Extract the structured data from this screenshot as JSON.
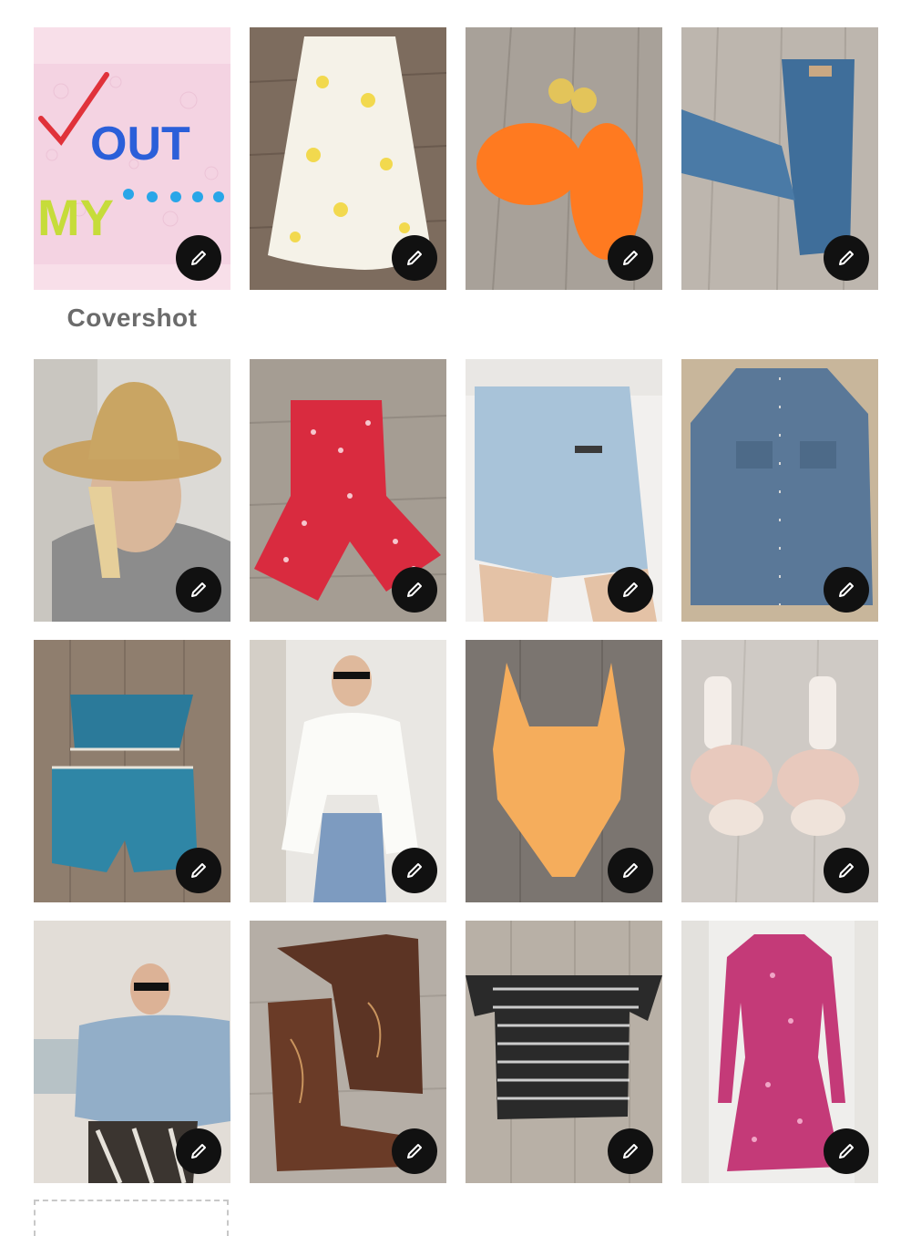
{
  "cover": {
    "label": "Covershot"
  },
  "edit_icon": "pencil-icon",
  "colors": {
    "edit_button": "#111111",
    "cover_label": "#6b6b6b",
    "wood_floor": "#8a7a6a"
  },
  "photos": [
    {
      "subject": "cover graphic",
      "caption_text": "✓OUT MY...."
    },
    {
      "subject": "white floral skirt"
    },
    {
      "subject": "orange jelly sandals"
    },
    {
      "subject": "blue jeans"
    },
    {
      "subject": "woman in straw hat"
    },
    {
      "subject": "red floral romper"
    },
    {
      "subject": "denim shorts"
    },
    {
      "subject": "denim western shirt"
    },
    {
      "subject": "crochet set"
    },
    {
      "subject": "woman in white tie top"
    },
    {
      "subject": "orange swimsuit"
    },
    {
      "subject": "bow sandals"
    },
    {
      "subject": "woman in denim jacket"
    },
    {
      "subject": "cowboy boots"
    },
    {
      "subject": "gingham top"
    },
    {
      "subject": "pink dress"
    }
  ]
}
